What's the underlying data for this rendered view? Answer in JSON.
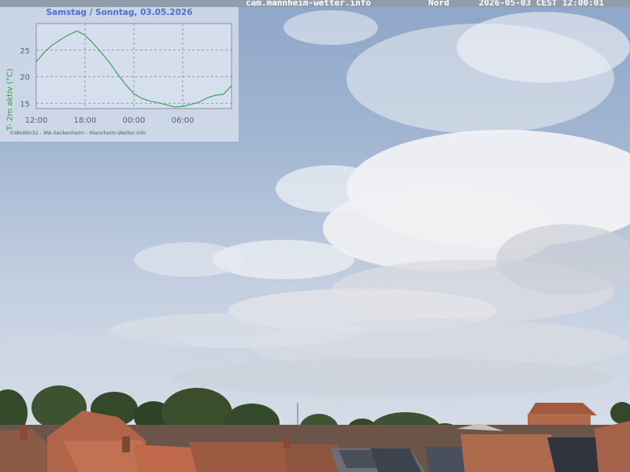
{
  "header": {
    "site": "cam.mannheim-wetter.info",
    "direction": "Nord",
    "timestamp": "2026-05-03 CEST 12:00:01"
  },
  "chart_data": {
    "type": "line",
    "title": "Samstag / Sonntag, 03.05.2026",
    "ylabel": "T- 2m aktiv (°C)",
    "xlabel": "",
    "x_ticks": [
      "12:00",
      "18:00",
      "00:00",
      "06:00"
    ],
    "y_ticks": [
      15,
      20,
      25
    ],
    "ylim": [
      14,
      30
    ],
    "grid": true,
    "legend": "none",
    "color": "#2e9c4a",
    "series": [
      {
        "x": [
          0,
          1,
          2,
          3,
          4,
          5,
          6,
          7,
          8,
          9,
          10,
          11,
          12,
          13,
          14,
          15,
          16,
          17,
          18,
          19,
          20,
          21,
          22,
          23,
          24
        ],
        "values": [
          22.8,
          24.6,
          26.0,
          27.0,
          27.9,
          28.6,
          27.8,
          26.3,
          24.5,
          22.7,
          20.5,
          18.5,
          16.8,
          15.9,
          15.4,
          15.1,
          14.7,
          14.3,
          14.4,
          14.8,
          15.2,
          16.0,
          16.5,
          16.7,
          18.3
        ]
      }
    ],
    "credit": "©WsWin32 - MA-Seckenheim - Mannheim-Wetter.info"
  }
}
